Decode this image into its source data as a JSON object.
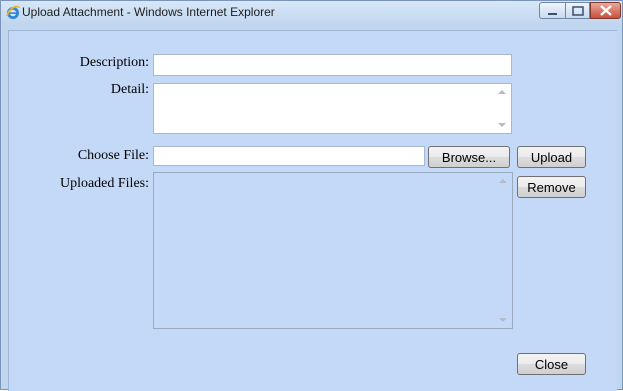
{
  "window": {
    "title": "Upload Attachment - Windows Internet Explorer"
  },
  "form": {
    "description_label": "Description:",
    "description_value": "",
    "detail_label": "Detail:",
    "detail_value": "",
    "choose_file_label": "Choose File:",
    "choose_file_value": "",
    "uploaded_files_label": "Uploaded Files:"
  },
  "buttons": {
    "browse": "Browse...",
    "upload": "Upload",
    "remove": "Remove",
    "close": "Close"
  },
  "colors": {
    "client_background": "#c4d9f7",
    "titlebar": "#c9dcf2",
    "close_button": "#c7503d"
  }
}
